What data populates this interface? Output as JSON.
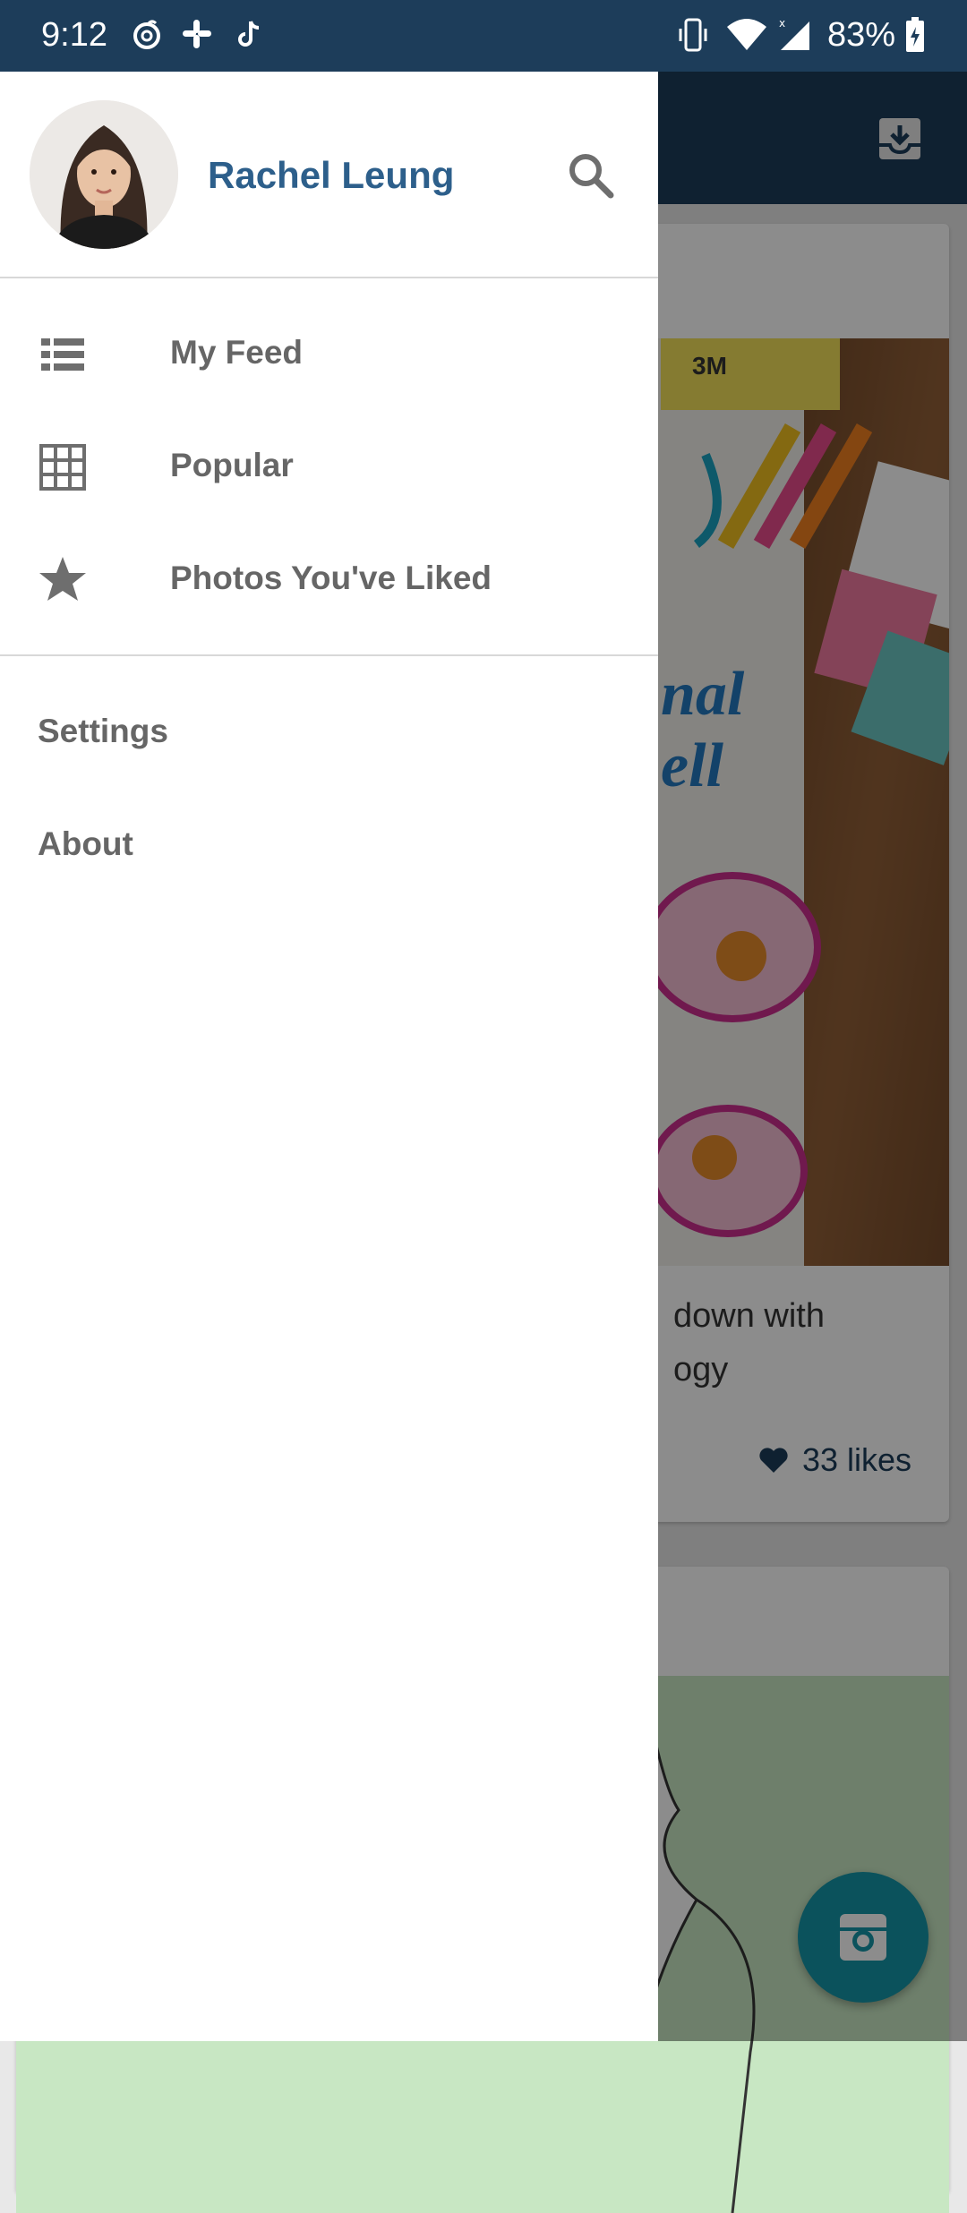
{
  "status_bar": {
    "time": "9:12",
    "notification_icons": [
      "netease-music-icon",
      "slack-icon",
      "tiktok-icon"
    ],
    "system_icons": [
      "vibrate-icon",
      "wifi-icon",
      "cell-signal-icon",
      "battery-charging-icon"
    ],
    "battery": "83%"
  },
  "drawer": {
    "profile_name": "Rachel Leung",
    "items": [
      {
        "label": "My Feed",
        "icon": "list-icon"
      },
      {
        "label": "Popular",
        "icon": "grid-icon"
      },
      {
        "label": "Photos You've Liked",
        "icon": "star-icon"
      }
    ],
    "secondary": [
      {
        "label": "Settings"
      },
      {
        "label": "About"
      }
    ]
  },
  "background": {
    "card1_caption_line1": "down with",
    "card1_caption_line2": "ogy",
    "card1_likes": "33 likes"
  },
  "colors": {
    "primary": "#1d3d5a",
    "accent": "#2d5f8b",
    "fab": "#1496a8",
    "drawer_text": "#666666"
  }
}
